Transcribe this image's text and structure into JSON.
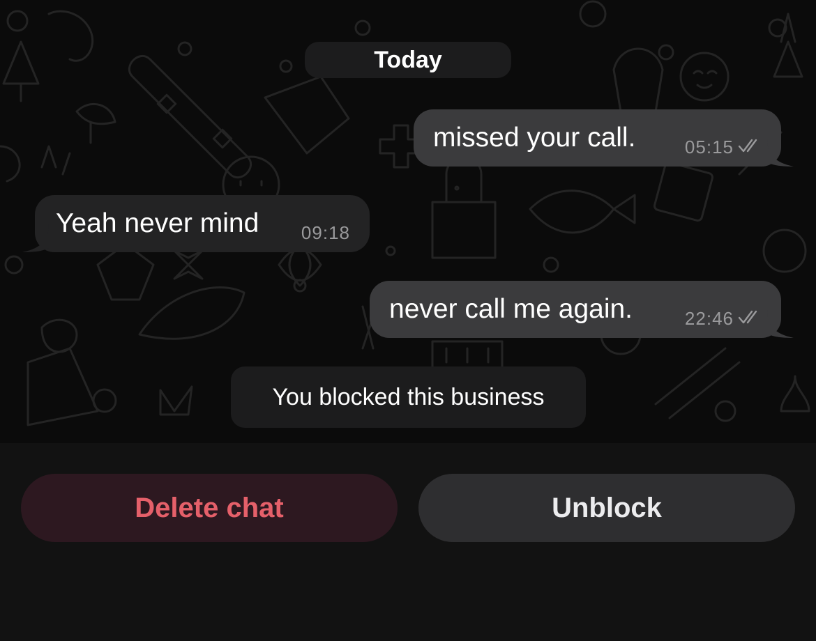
{
  "chat": {
    "date_label": "Today",
    "messages": [
      {
        "direction": "outgoing",
        "text": "missed your call.",
        "time": "05:15",
        "status": "read-double-check"
      },
      {
        "direction": "incoming",
        "text": "Yeah never mind",
        "time": "09:18"
      },
      {
        "direction": "outgoing",
        "text": "never call me again.",
        "time": "22:46",
        "status": "read-double-check"
      }
    ],
    "system_notice": "You blocked this business"
  },
  "footer": {
    "delete_label": "Delete chat",
    "unblock_label": "Unblock"
  },
  "colors": {
    "background": "#0b0b0b",
    "outgoing_bubble": "#3b3b3d",
    "incoming_bubble": "#232324",
    "delete_text": "#e5606a",
    "delete_bg": "#2d1820",
    "unblock_bg": "#2e2e30"
  }
}
